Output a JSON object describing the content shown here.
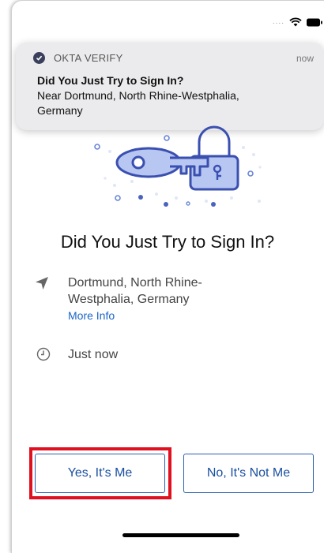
{
  "status_bar": {
    "signal": "....",
    "wifi_icon": "wifi-icon",
    "battery_icon": "battery-icon"
  },
  "notification": {
    "app_name": "OKTA VERIFY",
    "time": "now",
    "title": "Did You Just Try to Sign In?",
    "body": "Near Dortmund, North Rhine-Westphalia, Germany",
    "app_icon": "okta-verify-icon"
  },
  "main": {
    "illustration": "key-lock-illustration",
    "heading": "Did You Just Try to Sign In?",
    "location": {
      "icon": "location-arrow-icon",
      "text": "Dortmund, North Rhine-Westphalia, Germany",
      "more_info_label": "More Info"
    },
    "time": {
      "icon": "clock-icon",
      "text": "Just now"
    }
  },
  "actions": {
    "yes_label": "Yes, It's Me",
    "no_label": "No, It's Not Me"
  },
  "colors": {
    "accent": "#1a4fa0",
    "link": "#1a64c8",
    "highlight": "#e01020",
    "illustration_fill": "#b8c6f2",
    "illustration_stroke": "#3a50b0"
  }
}
